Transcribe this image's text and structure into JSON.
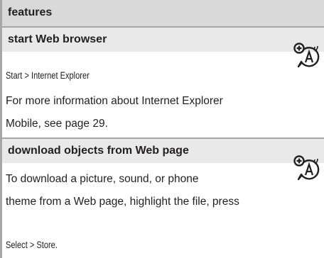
{
  "header": {
    "title": "features"
  },
  "sections": [
    {
      "title": "start Web browser",
      "path": "Start > Internet Explorer",
      "desc_line1": "For more information about Internet Explorer",
      "desc_line2": "Mobile, see page 29.",
      "icon": "network-feature-icon"
    },
    {
      "title": "download objects from Web page",
      "desc_line1": "To download a picture, sound, or phone",
      "desc_line2": "theme from a Web page, highlight the file, press",
      "path": "Select > Store.",
      "icon": "network-feature-icon"
    }
  ],
  "colors": {
    "rule": "#a6a6a6",
    "header_bg": "#d9d9d9",
    "subhead_bg": "#e9e9e9",
    "text": "#231f20"
  }
}
